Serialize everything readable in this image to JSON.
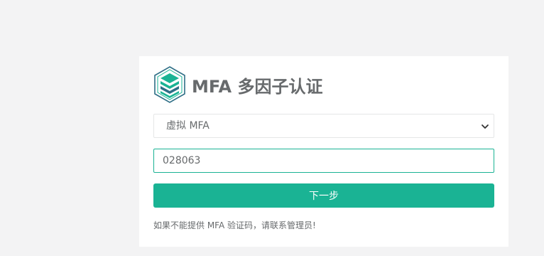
{
  "header": {
    "title": "MFA 多因子认证",
    "logo_icon": "layered-hexagon-logo-icon",
    "logo_colors": [
      "#1ab394",
      "#2e6e86"
    ]
  },
  "form": {
    "mfa_type": {
      "selected": "虚拟 MFA",
      "icon": "chevron-down-icon"
    },
    "code_input": {
      "value": "028063"
    },
    "submit_label": "下一步"
  },
  "help": {
    "text": "如果不能提供 MFA 验证码，请联系管理员!"
  },
  "colors": {
    "accent": "#1ab394",
    "text": "#676a6c",
    "background": "#f3f3f4",
    "card": "#ffffff",
    "border": "#e5e6e7"
  }
}
